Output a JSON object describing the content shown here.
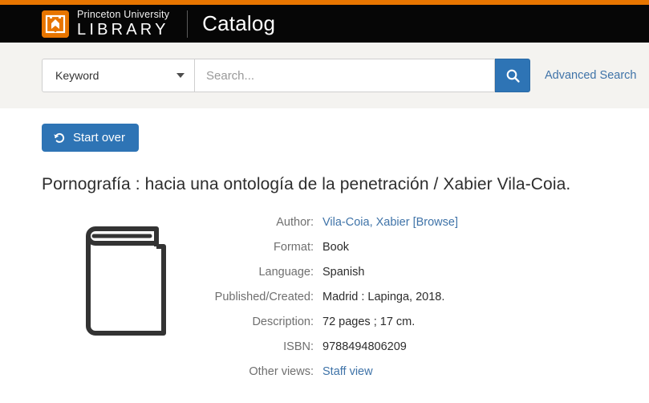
{
  "theme": {
    "accent_orange": "#e77500",
    "link_blue": "#3f73a8",
    "button_blue": "#2e74b5",
    "header_black": "#060606",
    "band_beige": "#f4f3f0"
  },
  "header": {
    "logo_icon": "princeton-library-book-shield-icon",
    "wordmark_line1": "Princeton University",
    "wordmark_line2": "LIBRARY",
    "app_name": "Catalog"
  },
  "search": {
    "field_selector_value": "Keyword",
    "field_selector_icon": "chevron-down-icon",
    "placeholder": "Search...",
    "query_value": "",
    "submit_icon": "search-icon",
    "advanced_link": "Advanced Search"
  },
  "toolbar": {
    "start_over_label": "Start over",
    "start_over_icon": "undo-arrow-icon"
  },
  "record": {
    "title": "Pornografía : hacia una ontología de la penetración / Xabier Vila-Coia.",
    "cover_icon": "book-placeholder-icon",
    "fields": [
      {
        "label": "Author:",
        "value": "Vila-Coia, Xabier [Browse]",
        "is_link": true
      },
      {
        "label": "Format:",
        "value": "Book",
        "is_link": false
      },
      {
        "label": "Language:",
        "value": "Spanish",
        "is_link": false
      },
      {
        "label": "Published/Created:",
        "value": "Madrid : Lapinga, 2018.",
        "is_link": false
      },
      {
        "label": "Description:",
        "value": "72 pages ; 17 cm.",
        "is_link": false
      },
      {
        "label": "ISBN:",
        "value": "9788494806209",
        "is_link": false
      },
      {
        "label": "Other views:",
        "value": "Staff view",
        "is_link": true
      }
    ]
  }
}
